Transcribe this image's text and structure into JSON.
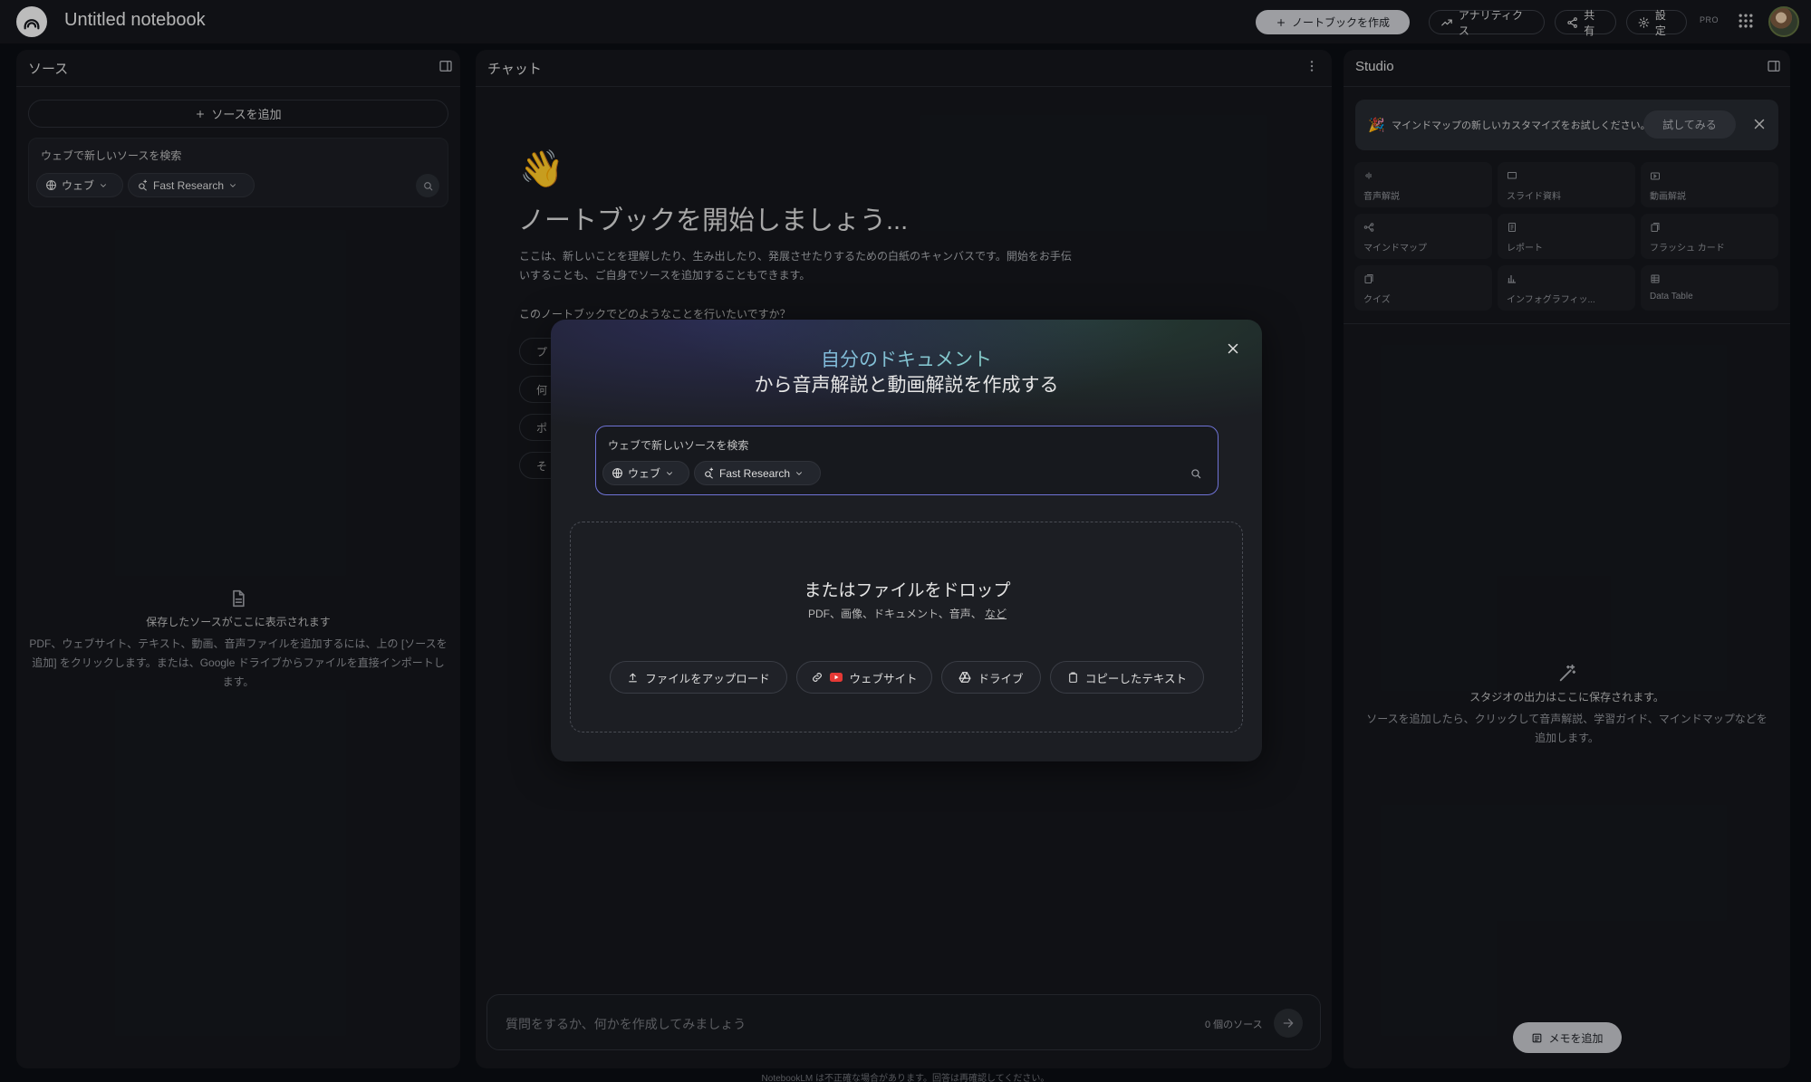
{
  "header": {
    "app_title": "Untitled notebook",
    "create_notebook": "ノートブックを作成",
    "analytics": "アナリティクス",
    "share": "共有",
    "settings": "設定",
    "plan_badge": "PRO"
  },
  "sources": {
    "title": "ソース",
    "add_source": "ソースを追加",
    "search_label": "ウェブで新しいソースを検索",
    "web_option": "ウェブ",
    "research_option": "Fast Research",
    "empty_title": "保存したソースがここに表示されます",
    "empty_desc": "PDF、ウェブサイト、テキスト、動画、音声ファイルを追加するには、上の [ソースを追加] をクリックします。または、Google ドライブからファイルを直接インポートします。"
  },
  "chat": {
    "title": "チャット",
    "wave_emoji": "👋",
    "heading": "ノートブックを開始しましょう...",
    "description": "ここは、新しいことを理解したり、生み出したり、発展させたりするための白紙のキャンバスです。開始をお手伝いすることも、ご自身でソースを追加することもできます。",
    "question": "このノートブックでどのようなことを行いたいですか？",
    "suggestions": [
      "プ",
      "何",
      "ポ",
      "そ"
    ],
    "input_placeholder": "質問をするか、何かを作成してみましょう",
    "source_count": "0 個のソース",
    "disclaimer": "NotebookLM は不正確な場合があります。回答は再確認してください。"
  },
  "studio": {
    "title": "Studio",
    "banner_text": "マインドマップの新しいカスタマイズをお試しください。",
    "banner_try": "試してみる",
    "tools": [
      {
        "label": "音声解説",
        "icon": "audio-icon"
      },
      {
        "label": "スライド資料",
        "icon": "slides-icon"
      },
      {
        "label": "動画解説",
        "icon": "video-icon"
      },
      {
        "label": "マインドマップ",
        "icon": "mindmap-icon"
      },
      {
        "label": "レポート",
        "icon": "report-icon"
      },
      {
        "label": "フラッシュ カード",
        "icon": "flashcard-icon"
      },
      {
        "label": "クイズ",
        "icon": "quiz-icon"
      },
      {
        "label": "インフォグラフィッ...",
        "icon": "infographic-icon"
      },
      {
        "label": "Data Table",
        "icon": "table-icon"
      }
    ],
    "empty_title": "スタジオの出力はここに保存されます。",
    "empty_desc": "ソースを追加したら、クリックして音声解説、学習ガイド、マインドマップなどを追加します。",
    "add_memo": "メモを追加"
  },
  "modal": {
    "heading_gradient": "自分のドキュメント",
    "heading_rest": "から音声解説と動画解説を作成する",
    "search_label": "ウェブで新しいソースを検索",
    "web_option": "ウェブ",
    "research_option": "Fast Research",
    "drop_title": "またはファイルをドロップ",
    "drop_types": "PDF、画像、ドキュメント、音声、",
    "drop_more": "など",
    "upload_file": "ファイルをアップロード",
    "website": "ウェブサイト",
    "drive": "ドライブ",
    "copied_text": "コピーしたテキスト"
  },
  "colors": {
    "background": "#0b0d12",
    "panel": "#15171c",
    "modal": "#1c1e23",
    "accent_border": "#6f73d6",
    "gradient_start": "#7fa2ff",
    "gradient_end": "#86e3a3"
  }
}
